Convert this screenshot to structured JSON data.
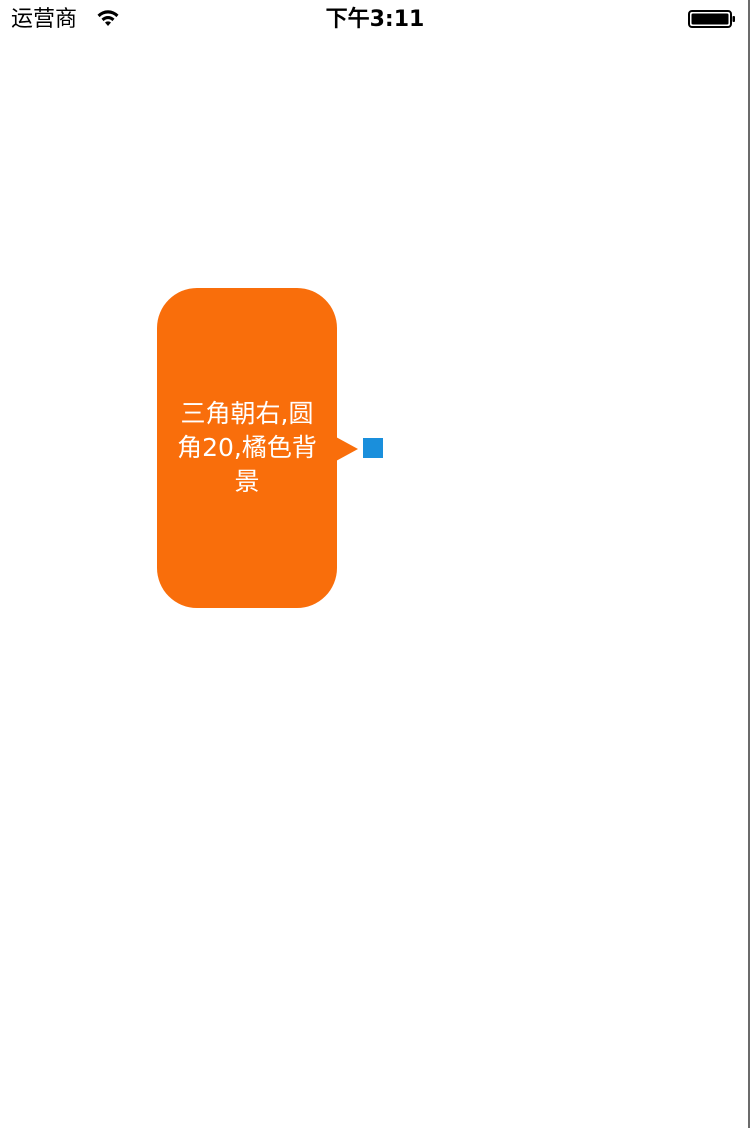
{
  "status_bar": {
    "carrier": "运营商",
    "time": "下午3:11",
    "wifi_icon": "wifi-icon",
    "battery_icon": "battery-icon"
  },
  "bubble": {
    "text": "三角朝右,圆角20,橘色背景",
    "background_color": "#f96e0b",
    "text_color": "#ffffff",
    "arrow_direction": "right"
  },
  "anchor": {
    "color": "#1a8fdc"
  }
}
